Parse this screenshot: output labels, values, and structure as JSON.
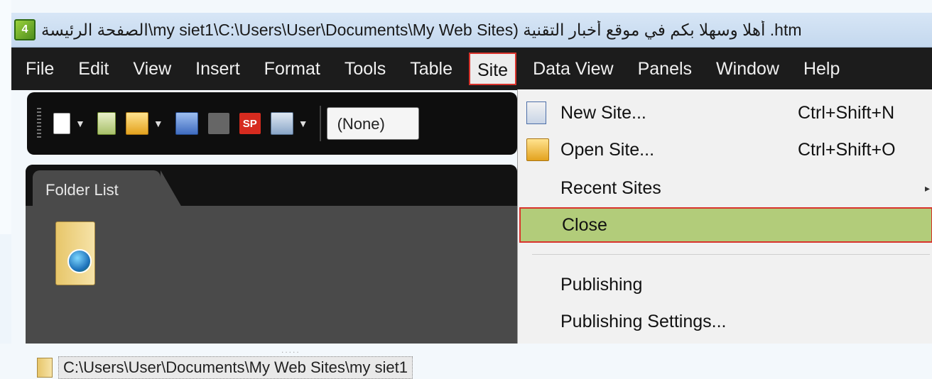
{
  "window": {
    "title": "الصفحة الرئيسة\\my siet1\\C:\\Users\\User\\Documents\\My Web Sites) أهلا وسهلا بكم في موقع أخبار التقنية .htm"
  },
  "app_icon_text": "4",
  "menu": {
    "items": [
      "File",
      "Edit",
      "View",
      "Insert",
      "Format",
      "Tools",
      "Table",
      "Site",
      "Data View",
      "Panels",
      "Window",
      "Help"
    ],
    "active": "Site"
  },
  "toolbar": {
    "style_select_value": "(None)",
    "sp_icon_text": "SP"
  },
  "folder_panel": {
    "tab_label": "Folder List",
    "path": "C:\\Users\\User\\Documents\\My Web Sites\\my siet1",
    "splitter": "....."
  },
  "site_menu": {
    "new_site": {
      "label": "New Site...",
      "shortcut": "Ctrl+Shift+N"
    },
    "open_site": {
      "label": "Open Site...",
      "shortcut": "Ctrl+Shift+O"
    },
    "recent_sites": {
      "label": "Recent Sites",
      "arrow": "▸"
    },
    "close": {
      "label": "Close"
    },
    "publishing": {
      "label": "Publishing"
    },
    "publishing_settings": {
      "label": "Publishing Settings..."
    }
  },
  "colors": {
    "menubar_bg": "#1c1c1c",
    "highlight_bg": "#b2cc7a",
    "annotation_red": "#d9332c"
  }
}
